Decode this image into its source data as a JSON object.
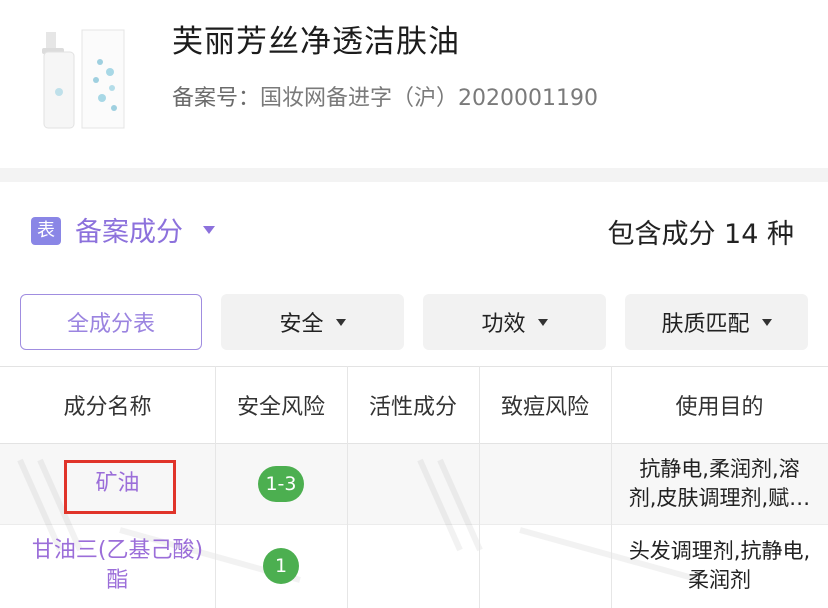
{
  "product": {
    "title": "芙丽芳丝净透洁肤油",
    "reg_label": "备案号：",
    "reg_value": "国妆网备进字（沪）2020001190"
  },
  "section": {
    "icon_char": "表",
    "title": "备案成分",
    "count_text": "包含成分 14 种"
  },
  "filters": [
    {
      "label": "全成分表"
    },
    {
      "label": "安全"
    },
    {
      "label": "功效"
    },
    {
      "label": "肤质匹配"
    }
  ],
  "table": {
    "headers": [
      "成分名称",
      "安全风险",
      "活性成分",
      "致痘风险",
      "使用目的"
    ],
    "rows": [
      {
        "name": "矿油",
        "safety": "1-3",
        "active": "",
        "acne": "",
        "purpose_l1": "抗静电,柔润剂,溶",
        "purpose_l2": "剂,皮肤调理剂,赋…"
      },
      {
        "name_l1": "甘油三(乙基己酸)",
        "name_l2": "酯",
        "safety": "1",
        "active": "",
        "acne": "",
        "purpose_l1": "头发调理剂,抗静电,",
        "purpose_l2": "柔润剂"
      }
    ]
  },
  "colors": {
    "accent": "#8c71dc",
    "badge_green": "#4caf50",
    "highlight_red": "#e0342a"
  }
}
